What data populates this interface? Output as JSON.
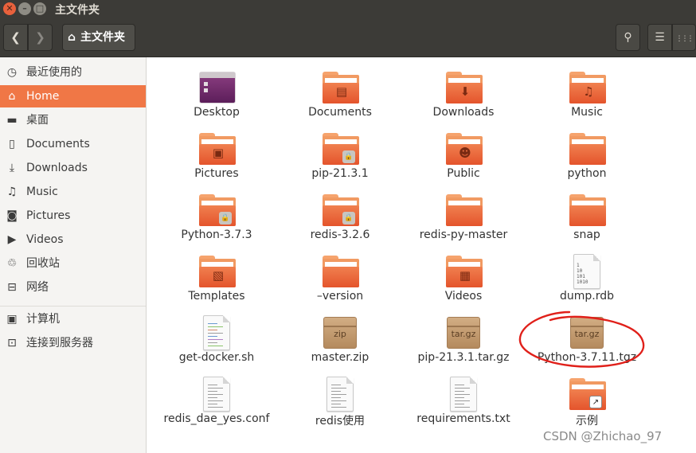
{
  "window": {
    "title": "主文件夹",
    "close_glyph": "✕",
    "min_glyph": "–",
    "max_glyph": "□"
  },
  "header": {
    "back_glyph": "❮",
    "forward_glyph": "❯",
    "path_home_glyph": "⌂",
    "path_label": "主文件夹",
    "search_glyph": "⚲",
    "list_glyph": "☰",
    "grid_glyph": "⋮⋮⋮"
  },
  "sidebar": {
    "items": [
      {
        "label": "最近使用的",
        "icon": "clock-icon",
        "glyph": "◷"
      },
      {
        "label": "Home",
        "icon": "home-icon",
        "glyph": "⌂",
        "active": true
      },
      {
        "label": "桌面",
        "icon": "desktop-folder-icon",
        "glyph": "▬"
      },
      {
        "label": "Documents",
        "icon": "document-icon",
        "glyph": "▯"
      },
      {
        "label": "Downloads",
        "icon": "download-icon",
        "glyph": "⤓"
      },
      {
        "label": "Music",
        "icon": "music-icon",
        "glyph": "♫"
      },
      {
        "label": "Pictures",
        "icon": "camera-icon",
        "glyph": "◙"
      },
      {
        "label": "Videos",
        "icon": "video-icon",
        "glyph": "▶"
      },
      {
        "label": "回收站",
        "icon": "trash-icon",
        "glyph": "♲"
      },
      {
        "label": "网络",
        "icon": "network-icon",
        "glyph": "⊟"
      },
      {
        "label": "计算机",
        "icon": "computer-icon",
        "glyph": "▣"
      },
      {
        "label": "连接到服务器",
        "icon": "server-icon",
        "glyph": "⊡"
      }
    ]
  },
  "files": [
    {
      "name": "Desktop",
      "kind": "desktop"
    },
    {
      "name": "Documents",
      "kind": "folder",
      "emblem": "document-emblem-icon",
      "glyph": "▤"
    },
    {
      "name": "Downloads",
      "kind": "folder",
      "emblem": "download-emblem-icon",
      "glyph": "⬇"
    },
    {
      "name": "Music",
      "kind": "folder",
      "emblem": "music-emblem-icon",
      "glyph": "♫"
    },
    {
      "name": "Pictures",
      "kind": "folder",
      "emblem": "picture-emblem-icon",
      "glyph": "▣"
    },
    {
      "name": "pip-21.3.1",
      "kind": "folder-locked",
      "lock_glyph": "🔒"
    },
    {
      "name": "Public",
      "kind": "folder",
      "emblem": "person-emblem-icon",
      "glyph": "☻"
    },
    {
      "name": "python",
      "kind": "folder"
    },
    {
      "name": "Python-3.7.3",
      "kind": "folder-locked",
      "lock_glyph": "🔒"
    },
    {
      "name": "redis-3.2.6",
      "kind": "folder-locked",
      "lock_glyph": "🔒"
    },
    {
      "name": "redis-py-master",
      "kind": "folder"
    },
    {
      "name": "snap",
      "kind": "folder"
    },
    {
      "name": "Templates",
      "kind": "folder",
      "emblem": "template-emblem-icon",
      "glyph": "▧"
    },
    {
      "name": "–version",
      "kind": "folder"
    },
    {
      "name": "Videos",
      "kind": "folder",
      "emblem": "film-emblem-icon",
      "glyph": "▦"
    },
    {
      "name": "dump.rdb",
      "kind": "binary",
      "bin": "1\n10\n101\n1010"
    },
    {
      "name": "get-docker.sh",
      "kind": "script"
    },
    {
      "name": "master.zip",
      "kind": "archive",
      "label": "zip"
    },
    {
      "name": "pip-21.3.1.tar.gz",
      "kind": "archive",
      "label": "tar.gz"
    },
    {
      "name": "Python-3.7.11.tgz",
      "kind": "archive",
      "label": "tar.gz"
    },
    {
      "name": "redis_dae_yes.conf",
      "kind": "text"
    },
    {
      "name": "redis使用",
      "kind": "text"
    },
    {
      "name": "requirements.txt",
      "kind": "text"
    },
    {
      "name": "示例",
      "kind": "folder-link",
      "link_glyph": "↗"
    }
  ],
  "annotation_color": "#e0201a",
  "watermark": "CSDN @Zhichao_97"
}
